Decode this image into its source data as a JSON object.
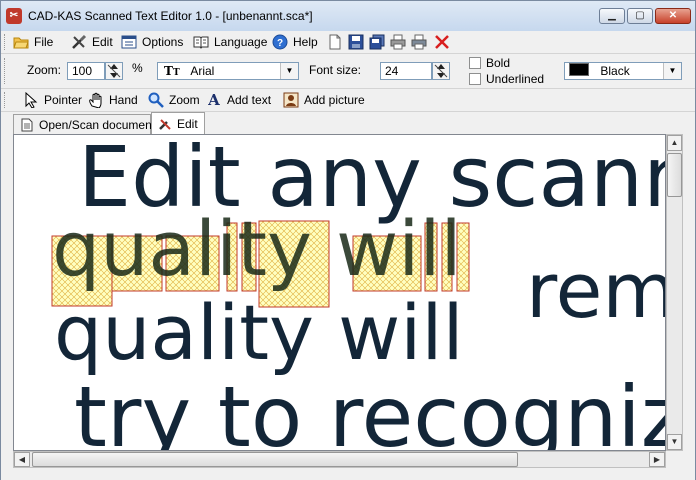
{
  "window": {
    "title": "CAD-KAS Scanned Text Editor 1.0 - [unbenannt.sca*]",
    "app_icon_glyph": "✂",
    "min_glyph": "▁",
    "max_glyph": "▢",
    "close_glyph": "✕"
  },
  "menu": {
    "file": "File",
    "edit": "Edit",
    "options": "Options",
    "language": "Language",
    "help": "Help"
  },
  "options_bar": {
    "zoom_label": "Zoom:",
    "zoom_value": "100",
    "zoom_unit": "%",
    "font_name": "Arial",
    "font_size_label": "Font size:",
    "font_size_value": "24",
    "bold_label": "Bold",
    "underlined_label": "Underlined",
    "color_name": "Black",
    "color_hex": "#000000"
  },
  "tools": {
    "pointer": "Pointer",
    "hand": "Hand",
    "zoom": "Zoom",
    "add_text": "Add text",
    "add_picture": "Add picture"
  },
  "tabs": {
    "open_scan": "Open/Scan document",
    "edit": "Edit"
  },
  "canvas_text": {
    "line1": "Edit any scann",
    "line2_highlighted": "quality will",
    "line2_right": "rem",
    "line3": "quality will",
    "line4": "try to recogniz"
  },
  "colors": {
    "text": "#132638",
    "highlight_fill": "#ffffc0",
    "highlight_border": "#c0392b"
  }
}
